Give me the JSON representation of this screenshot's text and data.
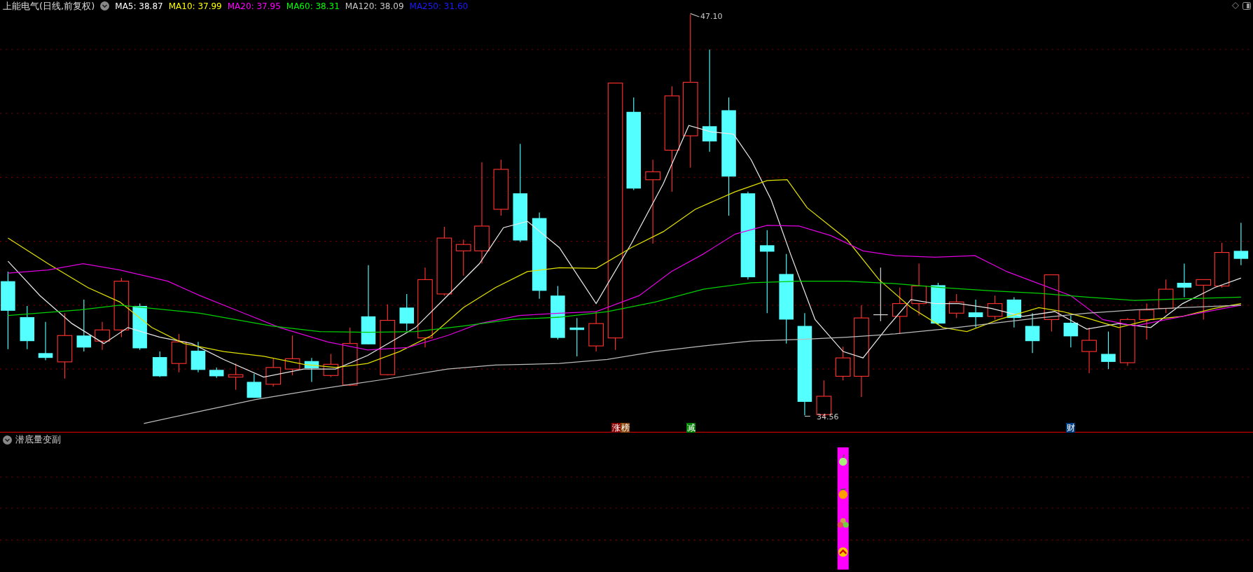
{
  "header": {
    "title": "上能电气(日线,前复权)",
    "ma_labels": [
      {
        "text": "MA5: 38.87",
        "color": "#ffffff"
      },
      {
        "text": "MA10: 37.99",
        "color": "#ffff00"
      },
      {
        "text": "MA20: 37.95",
        "color": "#ff00ff"
      },
      {
        "text": "MA60: 38.31",
        "color": "#00ff00"
      },
      {
        "text": "MA120: 38.09",
        "color": "#c8c8c8"
      },
      {
        "text": "MA250: 31.60",
        "color": "#1a1aff"
      }
    ]
  },
  "price_marks": [
    {
      "kind": "high",
      "text": "47.10"
    },
    {
      "kind": "low",
      "text": "34.56"
    }
  ],
  "event_badges": [
    {
      "text": "涨",
      "color": "#8b0000"
    },
    {
      "text": "榜",
      "color": "#8b4a10"
    },
    {
      "text": "减",
      "color": "#008000"
    },
    {
      "text": "财",
      "color": "#003c80"
    }
  ],
  "indicator": {
    "title": "潜底量变副"
  }
}
